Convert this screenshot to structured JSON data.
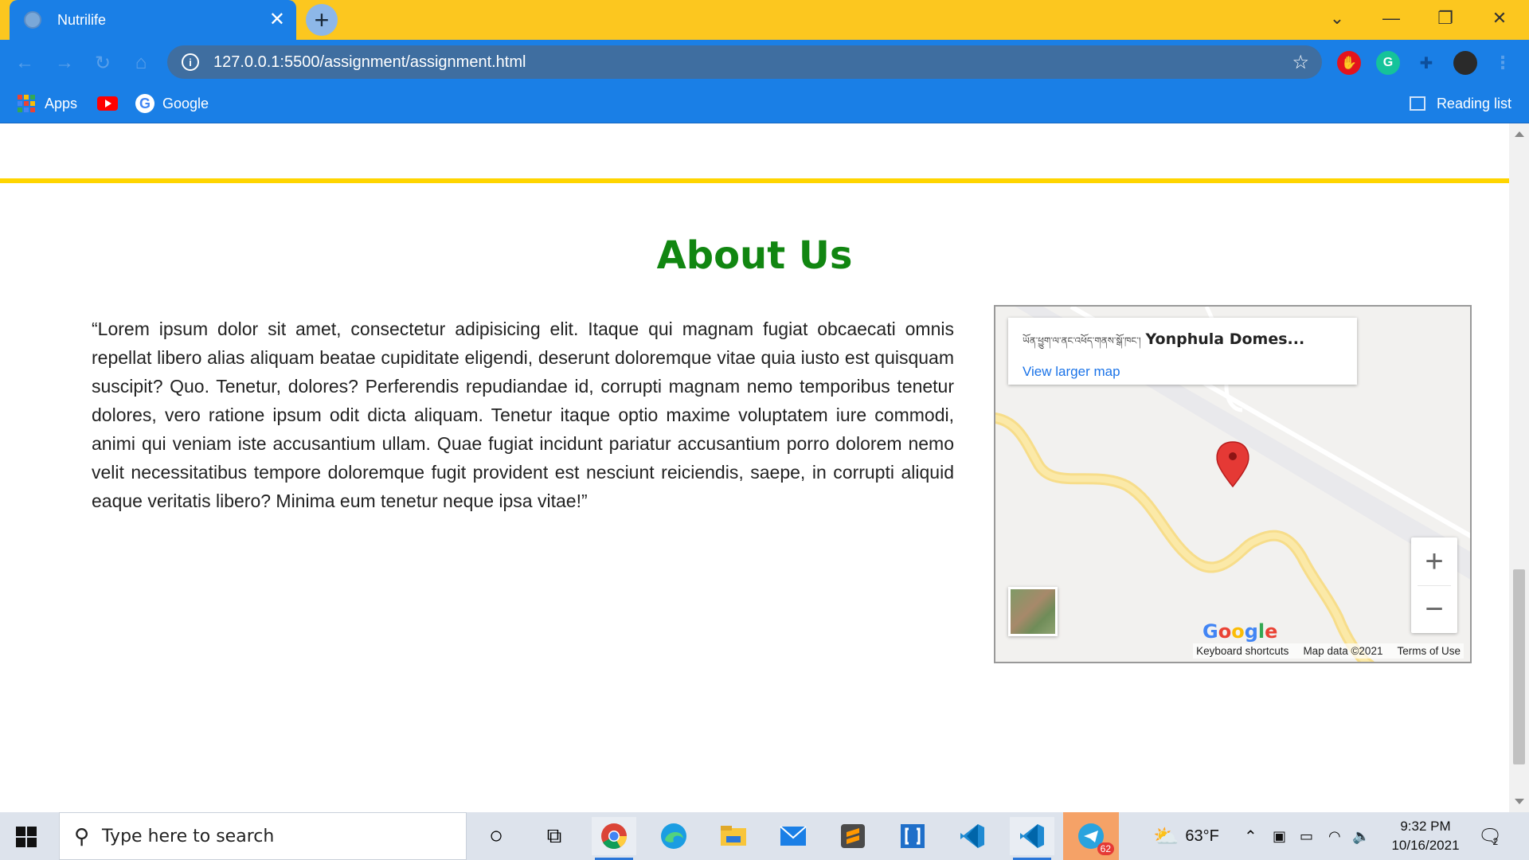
{
  "browser": {
    "tab_title": "Nutrilife",
    "tab_close": "✕",
    "new_tab": "+",
    "url": "127.0.0.1:5500/assignment/assignment.html",
    "bookmarks": [
      {
        "label": "Apps"
      },
      {
        "label": ""
      },
      {
        "label": "Google"
      }
    ],
    "reading_list": "Reading list",
    "window_controls": [
      "⌄",
      "—",
      "❐",
      "✕"
    ]
  },
  "page": {
    "heading": "About Us",
    "paragraph": "“Lorem ipsum dolor sit amet, consectetur adipisicing elit. Itaque qui magnam fugiat obcaecati omnis repellat libero alias aliquam beatae cupiditate eligendi, deserunt doloremque vitae quia iusto est quisquam suscipit? Quo. Tenetur, dolores? Perferendis repudiandae id, corrupti magnam nemo temporibus tenetur dolores, vero ratione ipsum odit dicta aliquam. Tenetur itaque optio maxime voluptatem iure commodi, animi qui veniam iste accusantium ullam. Quae fugiat incidunt pariatur accusantium porro dolorem nemo velit necessitatibus tempore doloremque fugit provident est nesciunt reiciendis, saepe, in corrupti aliquid eaque veritatis libero? Minima eum tenetur neque ipsa vitae!”",
    "map": {
      "place_tibetan": "ཡོན་ཕྱུག་ལ་ནང་འཕོད་གནས་སྒོ་ཁང་།",
      "place_name": "Yonphula Domes...",
      "larger_map": "View larger map",
      "zoom_in": "+",
      "zoom_out": "−",
      "logo": "Google",
      "footer": [
        "Keyboard shortcuts",
        "Map data ©2021",
        "Terms of Use"
      ]
    }
  },
  "taskbar": {
    "search_placeholder": "Type here to search",
    "weather": "63°F",
    "time": "9:32 PM",
    "date": "10/16/2021",
    "telegram_badge": "62",
    "notifications_badge": "2"
  },
  "colors": {
    "tabstrip": "#fcc71f",
    "toolbar": "#1a7fe6",
    "heading": "#118611",
    "divider": "#ffd500"
  }
}
